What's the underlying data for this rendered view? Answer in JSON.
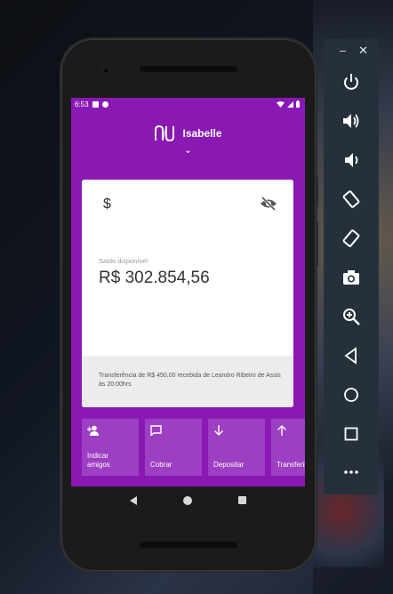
{
  "status_bar": {
    "time": "6:53"
  },
  "header": {
    "user_name": "Isabelle"
  },
  "balance_card": {
    "currency_symbol": "$",
    "label": "Saldo disponível",
    "amount": "R$ 302.854,56",
    "last_transaction": "Transferência de R$ 450,00 recebida de Leandro Ribeiro de Assis às 20:00hrs"
  },
  "shortcuts": [
    {
      "icon": "add-person-icon",
      "label": "Indicar amigos"
    },
    {
      "icon": "chat-icon",
      "label": "Cobrar"
    },
    {
      "icon": "arrow-down-icon",
      "label": "Depositar"
    },
    {
      "icon": "arrow-up-icon",
      "label": "Transferir"
    }
  ],
  "emulator_toolbar": {
    "buttons": [
      "power-icon",
      "volume-up-icon",
      "volume-down-icon",
      "rotate-left-icon",
      "rotate-right-icon",
      "camera-icon",
      "zoom-icon",
      "back-icon",
      "home-icon",
      "overview-icon",
      "more-icon"
    ]
  },
  "colors": {
    "brand": "#8a19b4",
    "shortcut_bg": "#9c3fc2",
    "toolbar_bg": "#25303a"
  }
}
